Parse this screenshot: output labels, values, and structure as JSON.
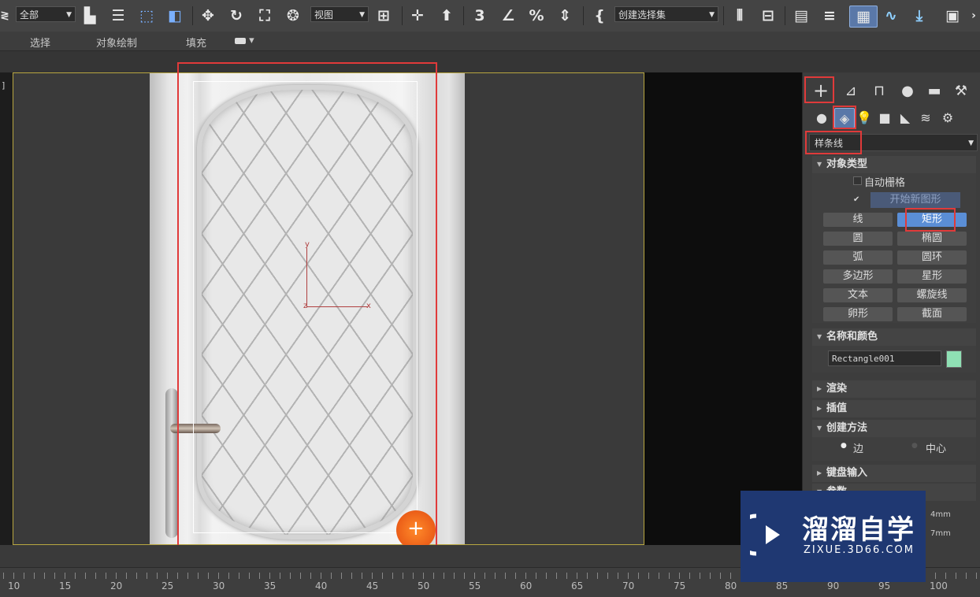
{
  "toolbar": {
    "selection_filter": "全部",
    "ref_coord": "视图",
    "named_selection": "创建选择集"
  },
  "ribbon": {
    "tabs": [
      "选择",
      "对象绘制",
      "填充"
    ],
    "extra": "▾"
  },
  "viewport": {
    "label": "]",
    "axis_y": "y",
    "axis_x": "x",
    "axis_z": "z"
  },
  "ruler": {
    "ticks": [
      "10",
      "15",
      "20",
      "25",
      "30",
      "35",
      "40",
      "45",
      "50",
      "55",
      "60",
      "65",
      "70",
      "75",
      "80",
      "85",
      "90",
      "95",
      "100"
    ]
  },
  "command_panel": {
    "category": "样条线",
    "object_type": {
      "title": "对象类型",
      "autogrid": "自动栅格",
      "start_new_shape": "开始新图形",
      "buttons": [
        "线",
        "矩形",
        "圆",
        "椭圆",
        "弧",
        "圆环",
        "多边形",
        "星形",
        "文本",
        "螺旋线",
        "卵形",
        "截面"
      ],
      "active": "矩形"
    },
    "name_color": {
      "title": "名称和颜色",
      "name": "Rectangle001",
      "color": "#8fe0b4"
    },
    "rollouts": [
      "渲染",
      "插值"
    ],
    "creation_method": {
      "title": "创建方法",
      "opt_edge": "边",
      "opt_center": "中心"
    },
    "keyboard_entry": "键盘输入",
    "params": "参数",
    "spin1": "4mm",
    "spin2": "7mm"
  },
  "watermark": {
    "title": "溜溜自学",
    "url": "ZIXUE.3D66.COM"
  },
  "colors": {
    "highlight": "#e03a3a",
    "active_button": "#5a8ed6",
    "viewport_border": "#b8a640"
  }
}
